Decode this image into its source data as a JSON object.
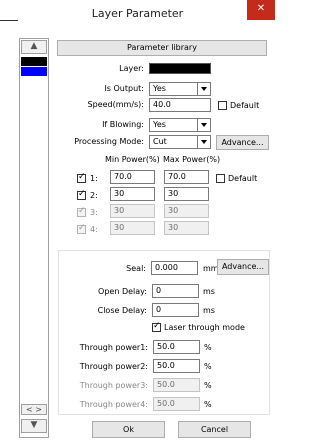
{
  "window": {
    "title": "Layer Parameter",
    "close_glyph": "✕"
  },
  "buttons": {
    "param_library": "Parameter library",
    "advance_mode": "Advance...",
    "advance_seal": "Advance...",
    "ok": "Ok",
    "cancel": "Cancel"
  },
  "scroll": {
    "up_glyph": "▲",
    "down_glyph": "▼",
    "lr_glyph": "< >"
  },
  "layer_list": {
    "colors": [
      "#000000",
      "#0000ff"
    ]
  },
  "form": {
    "layer_label": "Layer:",
    "layer_color": "#000000",
    "is_output_label": "Is Output:",
    "is_output_value": "Yes",
    "speed_label": "Speed(mm/s):",
    "speed_value": "40.0",
    "default_label": "Default",
    "if_blowing_label": "If Blowing:",
    "if_blowing_value": "Yes",
    "processing_mode_label": "Processing Mode:",
    "processing_mode_value": "Cut"
  },
  "power": {
    "min_header": "Min Power(%)",
    "max_header": "Max Power(%)",
    "default_label": "Default",
    "rows": [
      {
        "label": "1:",
        "min": "70.0",
        "max": "70.0",
        "checked": true,
        "enabled": true
      },
      {
        "label": "2:",
        "min": "30",
        "max": "30",
        "checked": true,
        "enabled": true
      },
      {
        "label": "3:",
        "min": "30",
        "max": "30",
        "checked": true,
        "enabled": false
      },
      {
        "label": "4:",
        "min": "30",
        "max": "30",
        "checked": true,
        "enabled": false
      }
    ]
  },
  "seal": {
    "label": "Seal:",
    "value": "0.000",
    "unit": "mm"
  },
  "delays": {
    "open_label": "Open Delay:",
    "open_value": "0",
    "open_unit": "ms",
    "close_label": "Close Delay:",
    "close_value": "0",
    "close_unit": "ms",
    "laser_through_label": "Laser through mode"
  },
  "through": [
    {
      "label": "Through power1:",
      "value": "50.0",
      "unit": "%",
      "enabled": true
    },
    {
      "label": "Through power2:",
      "value": "50.0",
      "unit": "%",
      "enabled": true
    },
    {
      "label": "Through power3:",
      "value": "50.0",
      "unit": "%",
      "enabled": false
    },
    {
      "label": "Through power4:",
      "value": "50.0",
      "unit": "%",
      "enabled": false
    }
  ]
}
